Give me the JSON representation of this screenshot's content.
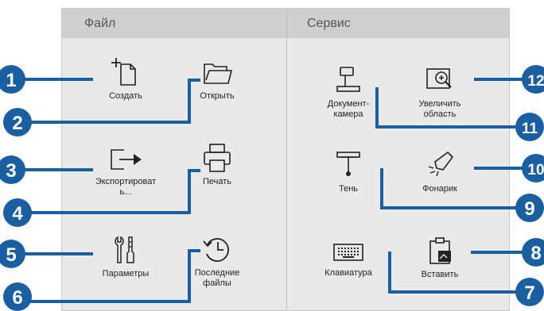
{
  "columns": {
    "file_title": "Файл",
    "service_title": "Сервис"
  },
  "items": {
    "create": "Создать",
    "open": "Открыть",
    "export_line1": "Экспортироват",
    "export_line2": "ь...",
    "print": "Печать",
    "settings": "Параметры",
    "recent_line1": "Последние",
    "recent_line2": "файлы",
    "doccam_line1": "Документ-",
    "doccam_line2": "камера",
    "zoom_line1": "Увеличить",
    "zoom_line2": "область",
    "shade": "Тень",
    "flashlight": "Фонарик",
    "keyboard": "Клавиатура",
    "paste": "Вставить"
  },
  "callouts": [
    "1",
    "2",
    "3",
    "4",
    "5",
    "6",
    "7",
    "8",
    "9",
    "10",
    "11",
    "12"
  ],
  "colors": {
    "callout": "#1a5fa0",
    "icon": "#222222",
    "panel": "#e9e9e9",
    "header": "#cfcfcf"
  },
  "icons": [
    "new-document-icon",
    "folder-icon",
    "export-icon",
    "printer-icon",
    "tools-icon",
    "history-icon",
    "document-camera-icon",
    "zoom-area-icon",
    "shade-icon",
    "flashlight-icon",
    "keyboard-icon",
    "paste-icon"
  ]
}
